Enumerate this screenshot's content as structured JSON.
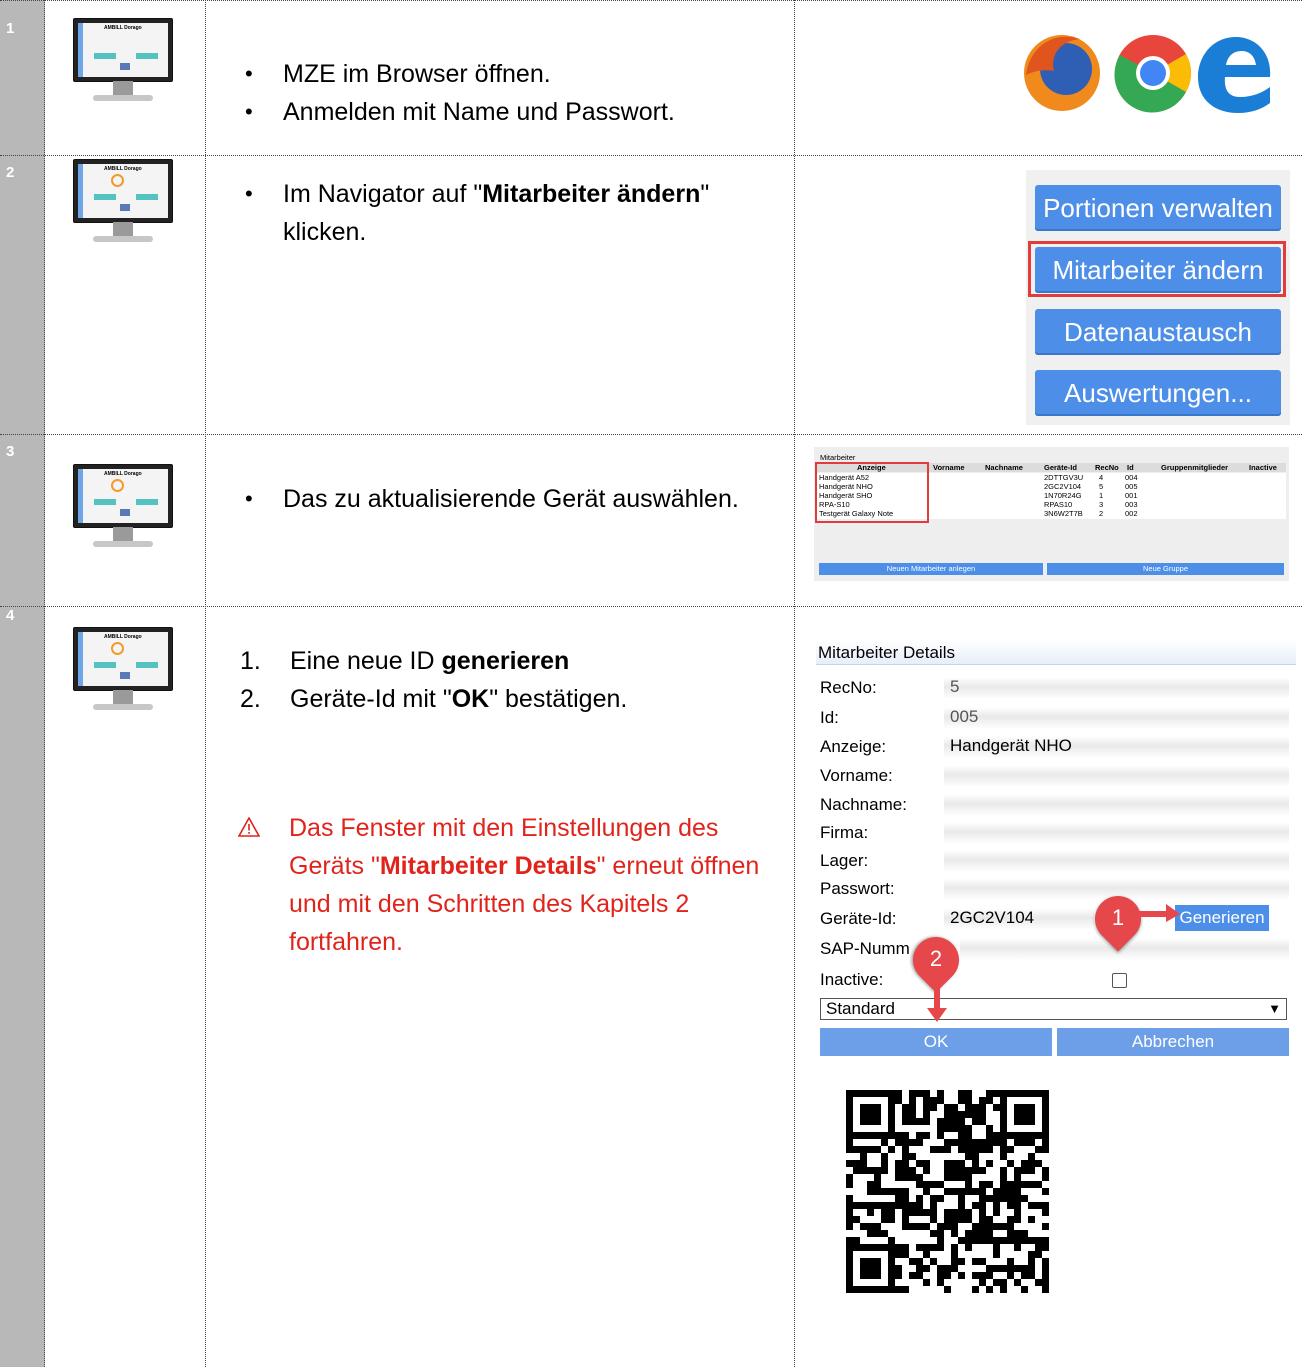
{
  "steps": [
    {
      "number": "1",
      "bullets": [
        "MZE im Browser öffnen.",
        "Anmelden mit Name und Passwort."
      ],
      "monitor_title": "AMBILL Dorago"
    },
    {
      "number": "2",
      "text_parts": [
        "Im Navigator auf \"",
        "Mitarbeiter ändern",
        "\" klicken."
      ],
      "monitor_title": "AMBILL Dorago"
    },
    {
      "number": "3",
      "bullets": [
        "Das zu aktualisierende Gerät auswählen."
      ],
      "monitor_title": "AMBILL Dorago"
    },
    {
      "number": "4",
      "items": [
        {
          "num": "1.",
          "pre": "Eine neue ID ",
          "bold": "generieren",
          "post": ""
        },
        {
          "num": "2.",
          "pre": "Geräte-Id mit \"",
          "bold": "OK",
          "post": "\" bestätigen."
        }
      ],
      "warning_icon": "warning-icon",
      "warning": {
        "pre": "Das Fenster mit den Einstellungen des Geräts \"",
        "bold": "Mitarbeiter Details",
        "post": "\" erneut öffnen und mit den Schritten des Kapitels 2 fortfahren."
      },
      "monitor_title": "AMBILL Dorago"
    }
  ],
  "browsers": [
    "firefox-icon",
    "chrome-icon",
    "edge-icon"
  ],
  "navigator": {
    "buttons": [
      "Portionen verwalten",
      "Mitarbeiter ändern",
      "Datenaustausch",
      "Auswertungen..."
    ],
    "highlighted": "Mitarbeiter ändern"
  },
  "mitarbeiter_table": {
    "caption": "Mitarbeiter",
    "columns": [
      "Anzeige",
      "Vorname",
      "Nachname",
      "Geräte-Id",
      "RecNo",
      "Id",
      "Gruppenmitglieder",
      "Inactive"
    ],
    "rows": [
      [
        "Handgerät A52",
        "",
        "",
        "2DTTGV3U",
        "4",
        "004",
        "",
        ""
      ],
      [
        "Handgerät NHO",
        "",
        "",
        "2GC2V104",
        "5",
        "005",
        "",
        ""
      ],
      [
        "Handgerät SHO",
        "",
        "",
        "1N70R24G",
        "1",
        "001",
        "",
        ""
      ],
      [
        "RPA-S10",
        "",
        "",
        "RPAS10",
        "3",
        "003",
        "",
        ""
      ],
      [
        "Testgerät Galaxy Note",
        "",
        "",
        "3N6W2T7B",
        "2",
        "002",
        "",
        ""
      ]
    ],
    "buttons": [
      "Neuen Mitarbeiter anlegen",
      "Neue Gruppe"
    ]
  },
  "details": {
    "title": "Mitarbeiter Details",
    "fields": [
      {
        "label": "RecNo:",
        "value": "5"
      },
      {
        "label": "Id:",
        "value": "005"
      },
      {
        "label": "Anzeige:",
        "value": "Handgerät  NHO"
      },
      {
        "label": "Vorname:",
        "value": ""
      },
      {
        "label": "Nachname:",
        "value": ""
      },
      {
        "label": "Firma:",
        "value": ""
      },
      {
        "label": "Lager:",
        "value": ""
      },
      {
        "label": "Passwort:",
        "value": ""
      },
      {
        "label": "Geräte-Id:",
        "value": "2GC2V104"
      },
      {
        "label": "SAP-Numm",
        "value": ""
      },
      {
        "label": "Inactive:",
        "value": ""
      }
    ],
    "generate_button": "Generieren",
    "select_value": "Standard",
    "ok_button": "OK",
    "cancel_button": "Abbrechen",
    "callouts": [
      "1",
      "2"
    ]
  }
}
